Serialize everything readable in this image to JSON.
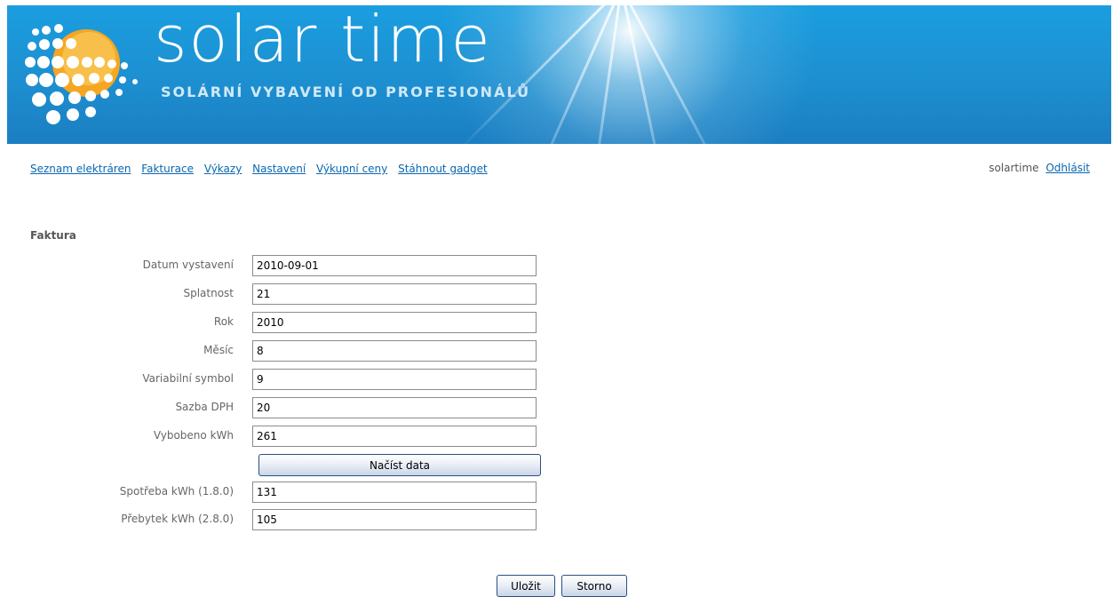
{
  "header": {
    "title": "solar time",
    "subtitle": "SOLÁRNÍ VYBAVENÍ OD PROFESIONÁLŮ"
  },
  "nav": {
    "items": [
      "Seznam elektráren",
      "Fakturace",
      "Výkazy",
      "Nastavení",
      "Výkupní ceny",
      "Stáhnout gadget"
    ]
  },
  "user": {
    "name": "solartime",
    "logout": "Odhlásit"
  },
  "form": {
    "title": "Faktura",
    "fields": [
      {
        "label": "Datum vystavení",
        "value": "2010-09-01"
      },
      {
        "label": "Splatnost",
        "value": "21"
      },
      {
        "label": "Rok",
        "value": "2010"
      },
      {
        "label": "Měsíc",
        "value": "8"
      },
      {
        "label": "Variabilní symbol",
        "value": "9"
      },
      {
        "label": "Sazba DPH",
        "value": "20"
      },
      {
        "label": "Vybobeno kWh",
        "value": "261"
      }
    ],
    "load_button": "Načíst data",
    "consumption_fields": [
      {
        "label": "Spotřeba kWh (1.8.0)",
        "value": "131"
      },
      {
        "label": "Přebytek kWh (2.8.0)",
        "value": "105"
      }
    ],
    "save_button": "Uložit",
    "cancel_button": "Storno"
  },
  "colors": {
    "banner": "#1d8fd0",
    "link": "#0a67b0",
    "sun": "#f5a623"
  }
}
